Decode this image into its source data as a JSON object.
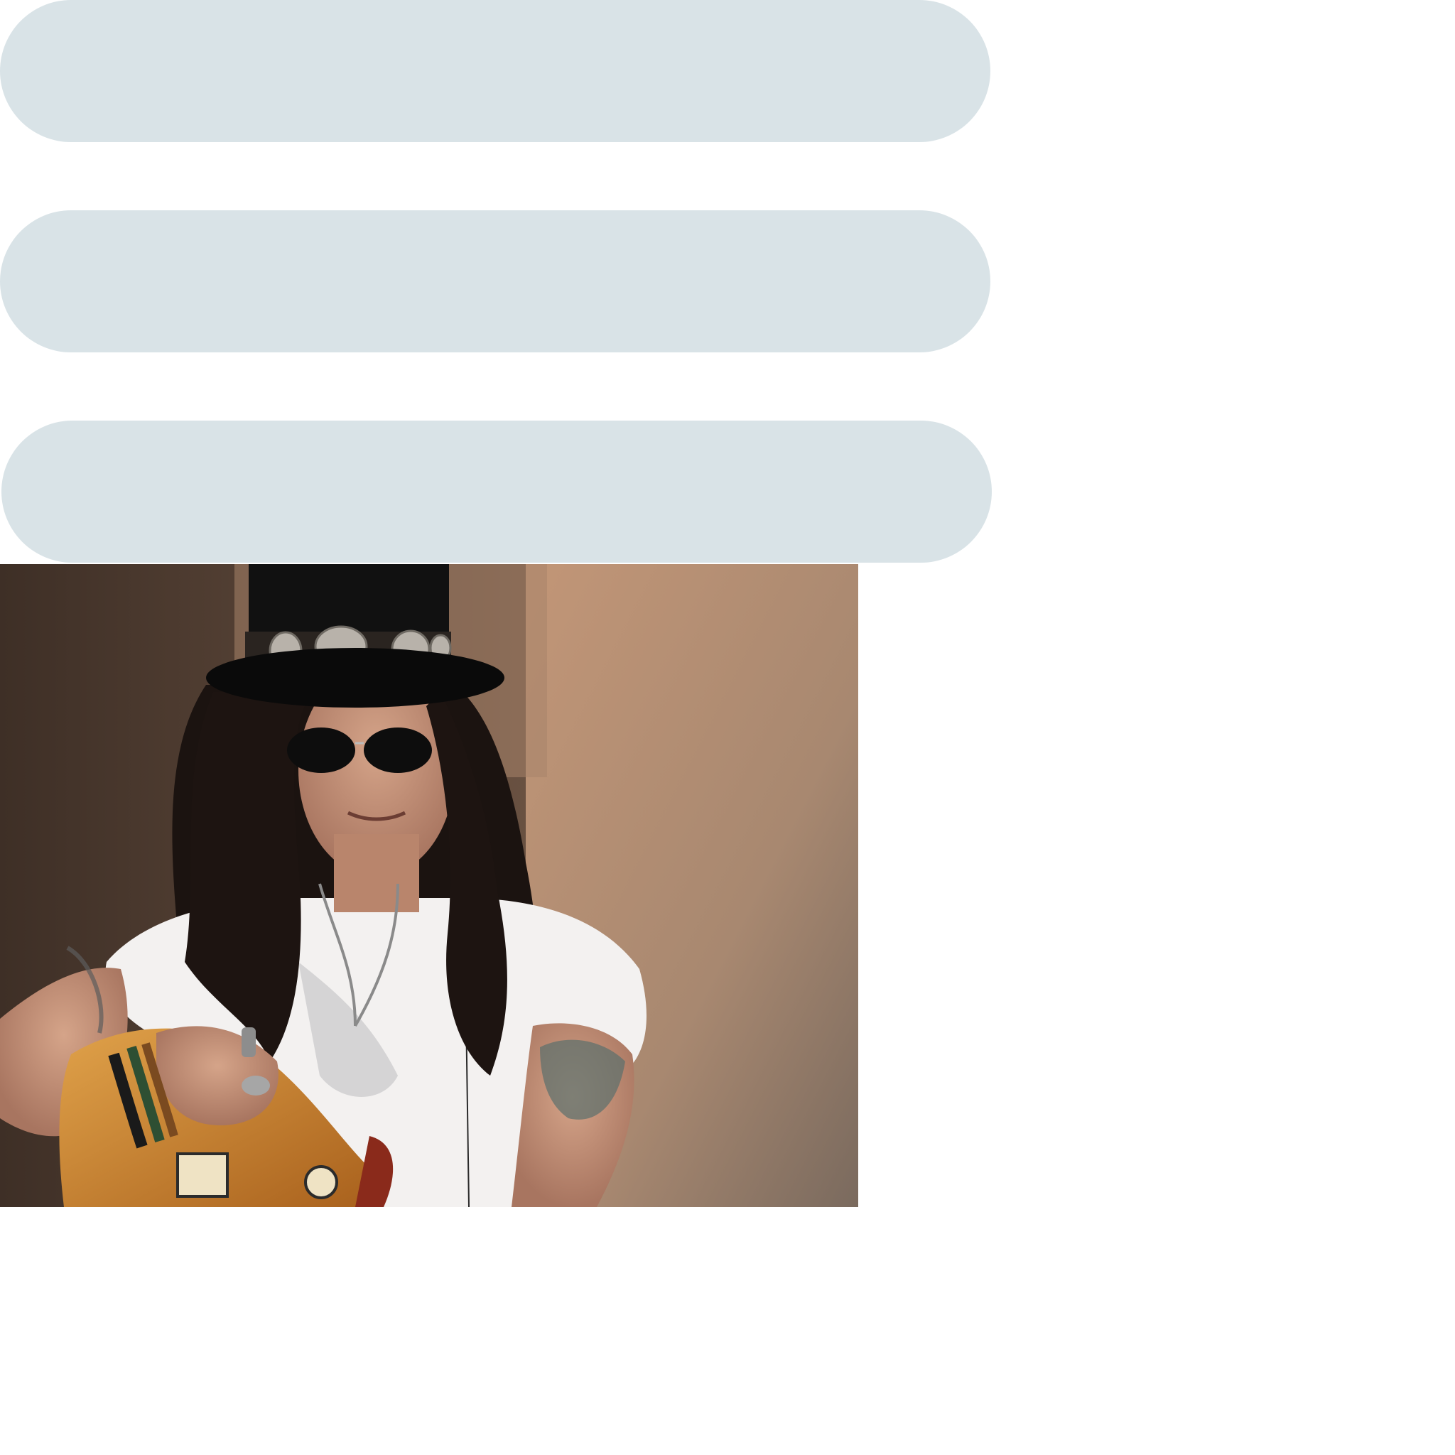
{
  "buttons": [
    {
      "label": ""
    },
    {
      "label": ""
    },
    {
      "label": ""
    }
  ],
  "photo": {
    "subject": "guitarist-portrait",
    "colors": {
      "wall_left": "#5a4536",
      "wall_right": "#b48d6f",
      "hat": "#111111",
      "shirt": "#f3f1f0",
      "guitar": "#c9822e",
      "hair": "#1b1310"
    }
  }
}
